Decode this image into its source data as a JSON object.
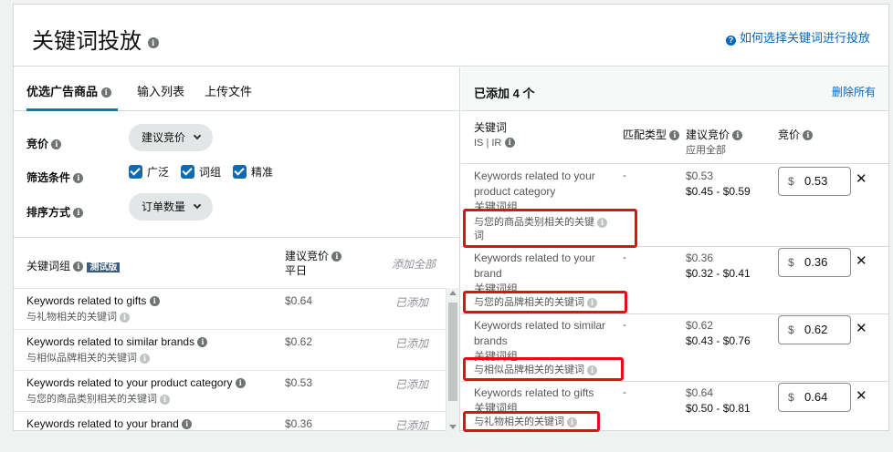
{
  "header": {
    "title": "关键词投放",
    "help_link": "如何选择关键词进行投放"
  },
  "left": {
    "tabs": [
      "优选广告商品",
      "输入列表",
      "上传文件"
    ],
    "bid_label": "竞价",
    "bid_select": "建议竞价",
    "filter_label": "筛选条件",
    "filters": [
      "广泛",
      "词组",
      "精准"
    ],
    "sort_label": "排序方式",
    "sort_select": "订单数量",
    "table": {
      "col_keyword": "关键词组",
      "beta": "测试版",
      "col_bid": "建议竞价",
      "col_bid_sub": "平日",
      "col_addall": "添加全部",
      "rows": [
        {
          "en": "Keywords related to gifts",
          "zh": "与礼物相关的关键词",
          "price": "$0.64",
          "status": "已添加"
        },
        {
          "en": "Keywords related to similar brands",
          "zh": "与相似品牌相关的关键词",
          "price": "$0.62",
          "status": "已添加"
        },
        {
          "en": "Keywords related to your product category",
          "zh": "与您的商品类别相关的关键词",
          "price": "$0.53",
          "status": "已添加"
        },
        {
          "en": "Keywords related to your brand",
          "zh": "",
          "price": "$0.36",
          "status": "已添加"
        }
      ]
    }
  },
  "right": {
    "added": "已添加 4 个",
    "remove_all": "删除所有",
    "cols": {
      "keyword": "关键词",
      "keyword_sub": "IS | IR",
      "match": "匹配类型",
      "sugg": "建议竞价",
      "sugg_sub": "应用全部",
      "bid": "竞价"
    },
    "rows": [
      {
        "en1": "Keywords related to your",
        "en2": "product category",
        "grp": "关键词组",
        "zh1": "与您的商品类别相关的关键",
        "zh2": "词",
        "dash": "-",
        "sugg": "$0.53",
        "range": "$0.45 - $0.59",
        "cur": "$",
        "bid": "0.53"
      },
      {
        "en1": "Keywords related to your",
        "en2": "brand",
        "grp": "关键词组",
        "zh1": "与您的品牌相关的关键词",
        "zh2": "",
        "dash": "-",
        "sugg": "$0.36",
        "range": "$0.32 - $0.41",
        "cur": "$",
        "bid": "0.36"
      },
      {
        "en1": "Keywords related to similar",
        "en2": "brands",
        "grp": "关键词组",
        "zh1": "与相似品牌相关的关键词",
        "zh2": "",
        "dash": "-",
        "sugg": "$0.62",
        "range": "$0.43 - $0.76",
        "cur": "$",
        "bid": "0.62"
      },
      {
        "en1": "Keywords related to gifts",
        "en2": "",
        "grp": "关键词组",
        "zh1": "与礼物相关的关键词",
        "zh2": "",
        "dash": "-",
        "sugg": "$0.64",
        "range": "$0.50 - $0.81",
        "cur": "$",
        "bid": "0.64"
      }
    ]
  },
  "colors": {
    "accent": "#008296",
    "link": "#0066c0",
    "highlight": "#e30f14",
    "checkbox": "#0f6ab4"
  }
}
